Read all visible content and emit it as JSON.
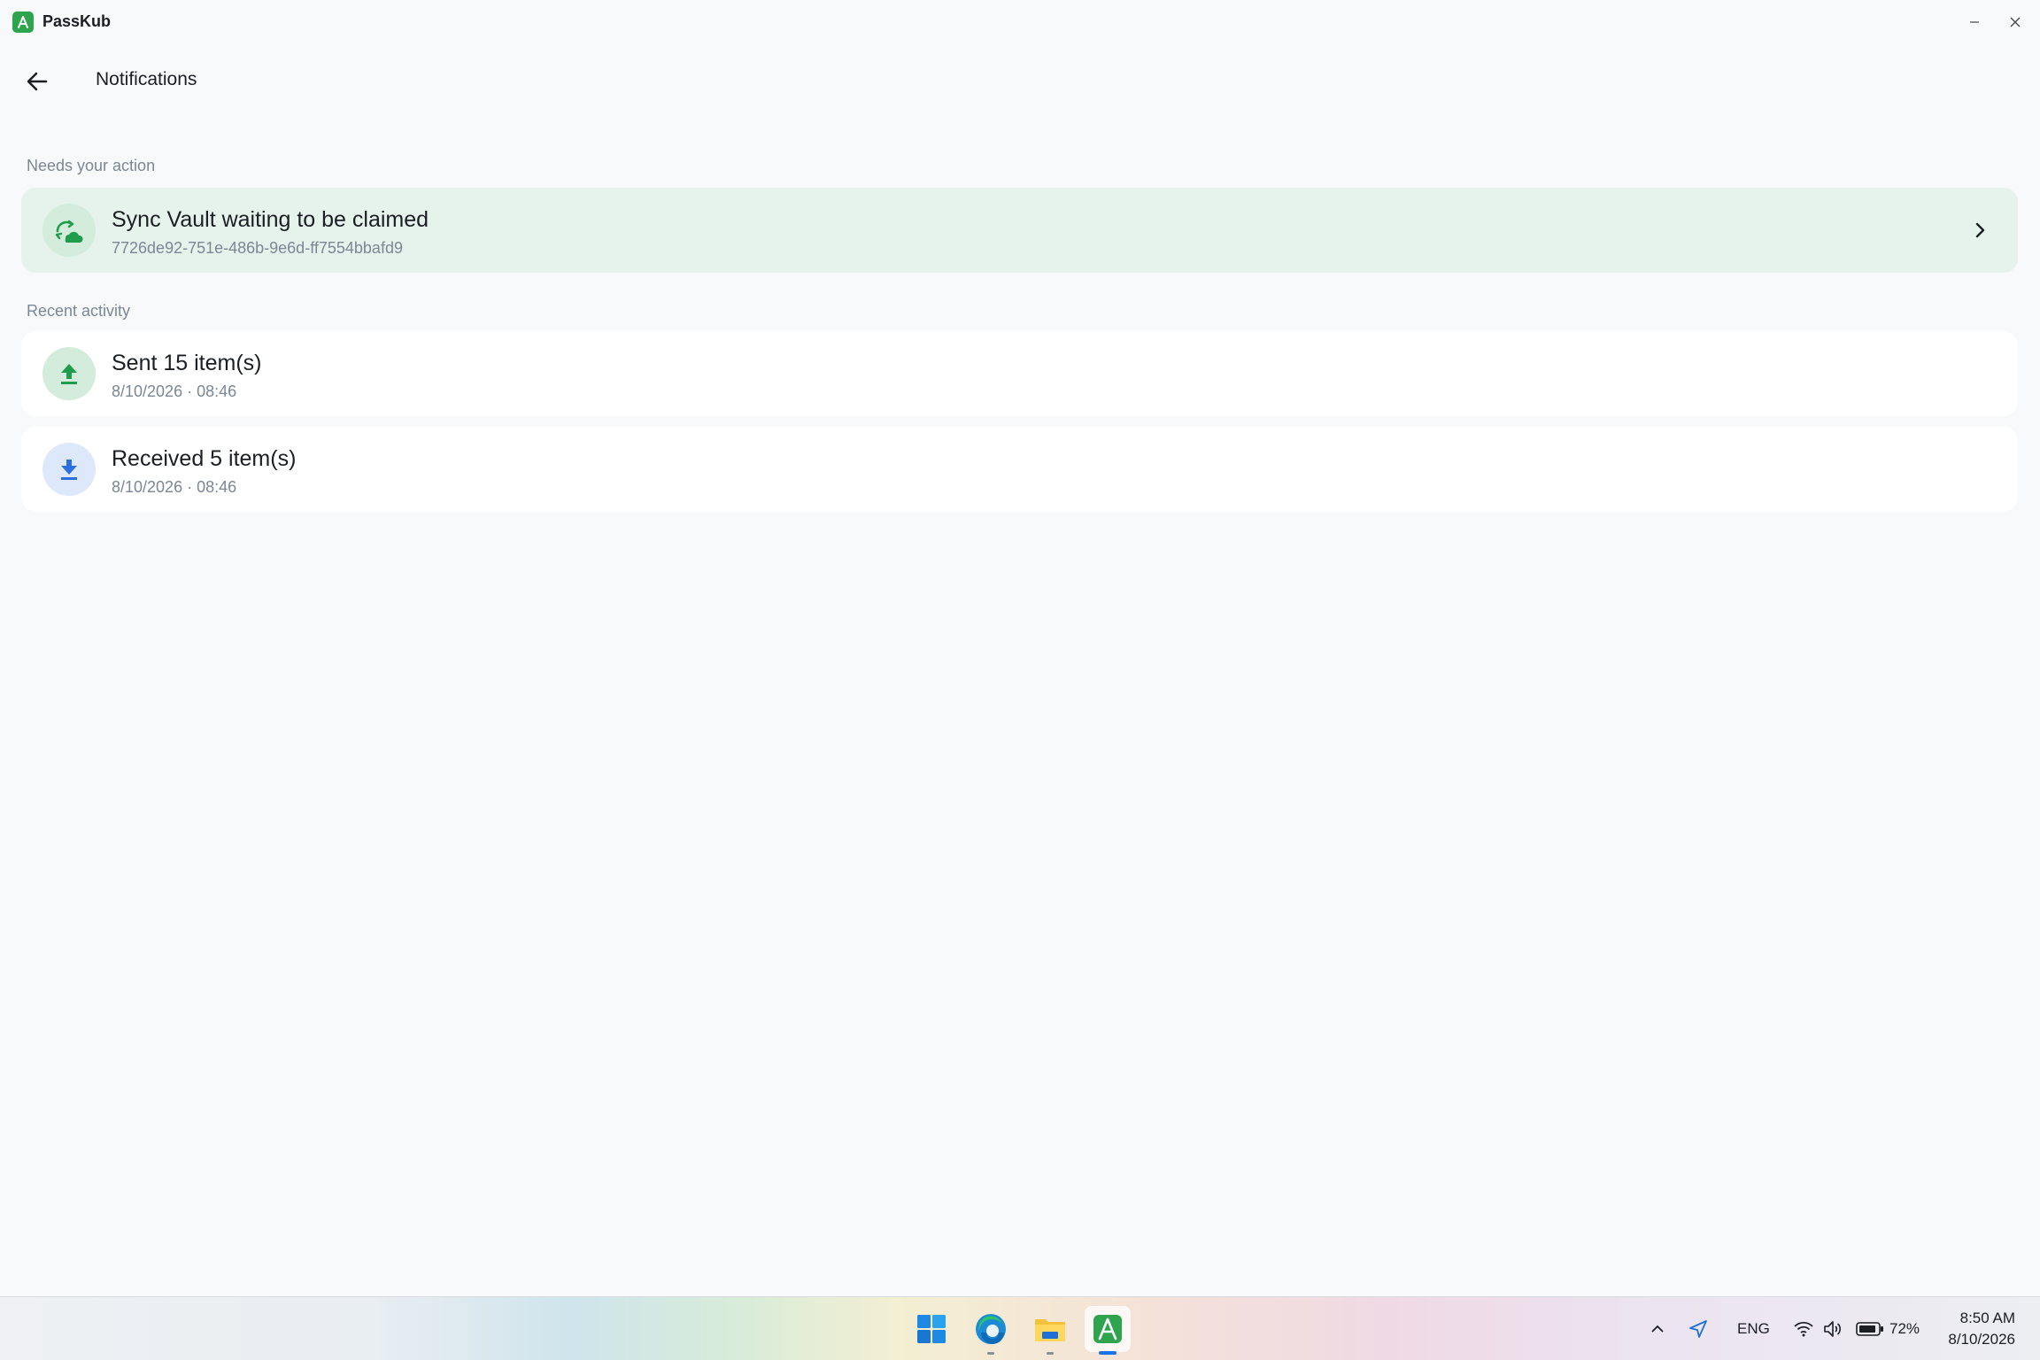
{
  "app": {
    "title": "PassKub"
  },
  "header": {
    "title": "Notifications"
  },
  "sections": {
    "action_label": "Needs your action",
    "recent_label": "Recent activity"
  },
  "action_card": {
    "title": "Sync Vault waiting to be claimed",
    "subtitle": "7726de92-751e-486b-9e6d-ff7554bbafd9",
    "icon": "cloud-sync-icon"
  },
  "activity": [
    {
      "title": "Sent 15 item(s)",
      "subtitle": "8/10/2026 · 08:46",
      "icon": "upload-icon",
      "color": "#1f9d4c"
    },
    {
      "title": "Received 5 item(s)",
      "subtitle": "8/10/2026 · 08:46",
      "icon": "download-icon",
      "color": "#2b6fe0"
    }
  ],
  "taskbar": {
    "apps": [
      "windows-start-icon",
      "edge-icon",
      "file-explorer-icon",
      "passkub-icon"
    ],
    "tray": {
      "language": "ENG",
      "battery": "72%",
      "time": "8:50 AM",
      "date": "8/10/2026"
    }
  },
  "colors": {
    "accent": "#2ea44f",
    "action_bg": "#e6f3ec",
    "background": "#f7f9fb"
  }
}
